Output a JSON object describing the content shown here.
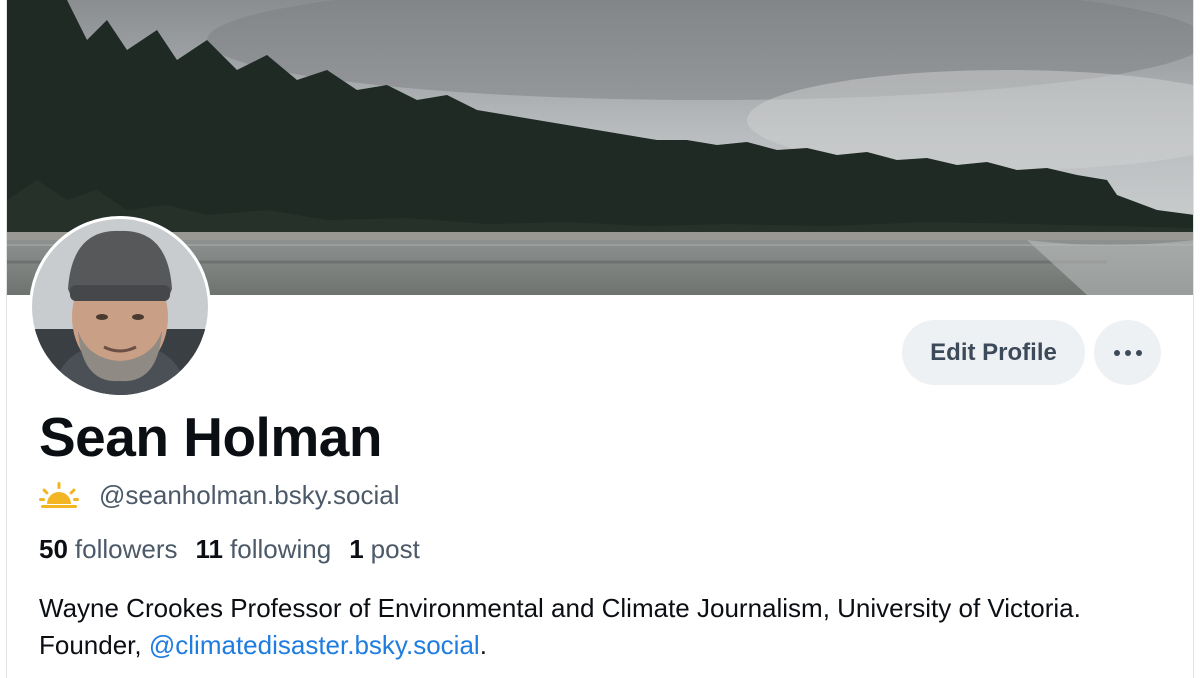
{
  "profile": {
    "display_name": "Sean Holman",
    "handle": "@seanholman.bsky.social",
    "handle_emoji_icon": "sunrise-icon",
    "stats": [
      {
        "count": "50",
        "label": "followers"
      },
      {
        "count": "11",
        "label": "following"
      },
      {
        "count": "1",
        "label": "post"
      }
    ],
    "bio": {
      "text": "Wayne Crookes Professor of Environmental and Climate Journalism, University of Victoria. Founder,",
      "mention": "@climatedisaster.bsky.social",
      "trailing": "."
    }
  },
  "actions": {
    "edit_label": "Edit Profile",
    "more_icon": "ellipsis-icon"
  },
  "colors": {
    "accent": "#1f7ce0",
    "button_bg": "#eef1f4",
    "muted_text": "#4b5968"
  }
}
